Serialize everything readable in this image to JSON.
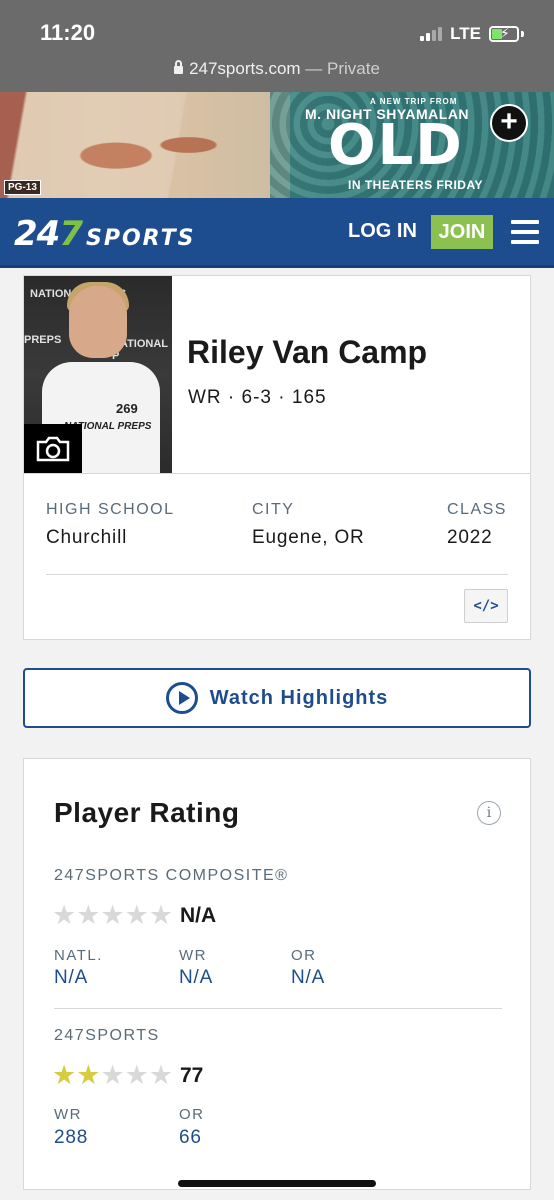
{
  "status_bar": {
    "time": "11:20",
    "network": "LTE",
    "url": "247sports.com",
    "url_suffix": " — Private"
  },
  "ad": {
    "rating": "PG-13",
    "tagline": "A NEW TRIP FROM",
    "director": "M. NIGHT SHYAMALAN",
    "title": "OLD",
    "subtitle": "IN THEATERS FRIDAY"
  },
  "header": {
    "logo_number_a": "24",
    "logo_number_b": "7",
    "logo_word": "SPORTS",
    "login_label": "LOG IN",
    "join_label": "JOIN"
  },
  "player": {
    "name": "Riley Van Camp",
    "meta": "WR · 6-3 · 165",
    "photo_text": {
      "top": "NATIONAL PREPS",
      "left": "PREPS",
      "mid": "NATIONAL P",
      "number": "269",
      "shirt": "NATIONAL PREPS"
    },
    "info": [
      {
        "label": "HIGH SCHOOL",
        "value": "Churchill"
      },
      {
        "label": "CITY",
        "value": "Eugene, OR"
      },
      {
        "label": "CLASS",
        "value": "2022"
      }
    ],
    "embed_label": "</>"
  },
  "highlights": {
    "label": "Watch Highlights"
  },
  "rating": {
    "title": "Player Rating",
    "info_icon": "i",
    "composite": {
      "label": "247SPORTS COMPOSITE®",
      "stars_filled": 0,
      "stars_total": 5,
      "value": "N/A",
      "ranks": [
        {
          "label": "NATL.",
          "value": "N/A"
        },
        {
          "label": "WR",
          "value": "N/A"
        },
        {
          "label": "OR",
          "value": "N/A"
        }
      ]
    },
    "sports247": {
      "label": "247SPORTS",
      "stars_filled": 2,
      "stars_total": 5,
      "value": "77",
      "ranks": [
        {
          "label": "WR",
          "value": "288"
        },
        {
          "label": "OR",
          "value": "66"
        }
      ]
    }
  },
  "colors": {
    "brand_blue": "#1d4d8f",
    "join_green": "#8cc152",
    "star_gold": "#d7cc3f"
  }
}
